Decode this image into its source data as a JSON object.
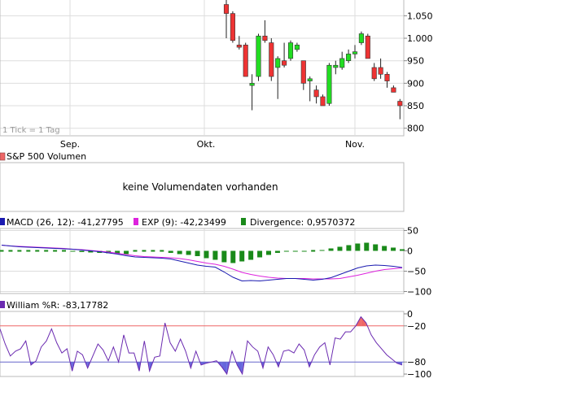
{
  "colors": {
    "up": "#22dd22",
    "down": "#ee3333",
    "grid": "#dddddd",
    "frame": "#bbbbbb",
    "macd": "#1a1ab0",
    "exp": "#dd22dd",
    "divergence": "#1a8a1a",
    "williams": "#6a2ab0",
    "overbought": "#ee6666",
    "oversold": "#6666cc"
  },
  "chart_data": [
    {
      "type": "candlestick",
      "tick_note": "1 Tick = 1 Tag",
      "x_months": [
        "Sep.",
        "Okt.",
        "Nov."
      ],
      "ylim": [
        785,
        1085
      ],
      "yticks": [
        "1.050",
        "1.000",
        "950",
        "900",
        "850",
        "800"
      ],
      "ytick_values": [
        1050,
        1000,
        950,
        900,
        850,
        800
      ],
      "candles": [
        {
          "o": 1075,
          "h": 1085,
          "l": 1000,
          "c": 1055
        },
        {
          "o": 1055,
          "h": 1060,
          "l": 990,
          "c": 995
        },
        {
          "o": 985,
          "h": 1005,
          "l": 975,
          "c": 980
        },
        {
          "o": 985,
          "h": 990,
          "l": 915,
          "c": 915
        },
        {
          "o": 895,
          "h": 920,
          "l": 840,
          "c": 900
        },
        {
          "o": 915,
          "h": 1010,
          "l": 905,
          "c": 1005
        },
        {
          "o": 1005,
          "h": 1040,
          "l": 990,
          "c": 995
        },
        {
          "o": 990,
          "h": 1000,
          "l": 905,
          "c": 915
        },
        {
          "o": 935,
          "h": 960,
          "l": 865,
          "c": 955
        },
        {
          "o": 950,
          "h": 990,
          "l": 935,
          "c": 940
        },
        {
          "o": 955,
          "h": 995,
          "l": 950,
          "c": 990
        },
        {
          "o": 975,
          "h": 990,
          "l": 970,
          "c": 985
        },
        {
          "o": 950,
          "h": 950,
          "l": 885,
          "c": 900
        },
        {
          "o": 905,
          "h": 915,
          "l": 860,
          "c": 910
        },
        {
          "o": 885,
          "h": 895,
          "l": 855,
          "c": 870
        },
        {
          "o": 870,
          "h": 875,
          "l": 850,
          "c": 850
        },
        {
          "o": 855,
          "h": 945,
          "l": 850,
          "c": 940
        },
        {
          "o": 935,
          "h": 950,
          "l": 920,
          "c": 940
        },
        {
          "o": 935,
          "h": 970,
          "l": 930,
          "c": 955
        },
        {
          "o": 950,
          "h": 975,
          "l": 945,
          "c": 965
        },
        {
          "o": 965,
          "h": 985,
          "l": 955,
          "c": 970
        },
        {
          "o": 990,
          "h": 1015,
          "l": 985,
          "c": 1010
        },
        {
          "o": 1005,
          "h": 1010,
          "l": 955,
          "c": 955
        },
        {
          "o": 935,
          "h": 945,
          "l": 905,
          "c": 910
        },
        {
          "o": 935,
          "h": 955,
          "l": 910,
          "c": 920
        },
        {
          "o": 920,
          "h": 925,
          "l": 890,
          "c": 905
        },
        {
          "o": 890,
          "h": 895,
          "l": 880,
          "c": 880
        },
        {
          "o": 860,
          "h": 865,
          "l": 820,
          "c": 850
        }
      ]
    },
    {
      "type": "volume",
      "title": "S&P 500 Volumen",
      "message": "keine Volumendaten vorhanden"
    },
    {
      "type": "line",
      "legend": [
        {
          "name": "MACD (26, 12):",
          "value": "-41,27795"
        },
        {
          "name": "EXP (9):",
          "value": "-42,23499"
        },
        {
          "name": "Divergence:",
          "value": "0,9570372"
        }
      ],
      "ylim": [
        -105,
        55
      ],
      "yticks": [
        50,
        0,
        -50,
        -100
      ],
      "macd": [
        14,
        12,
        10,
        9,
        8,
        7,
        6,
        5,
        4,
        2,
        0,
        -2,
        -5,
        -8,
        -12,
        -15,
        -16,
        -17,
        -18,
        -20,
        -25,
        -30,
        -35,
        -38,
        -40,
        -52,
        -65,
        -74,
        -73,
        -74,
        -72,
        -70,
        -68,
        -68,
        -70,
        -72,
        -70,
        -66,
        -58,
        -50,
        -42,
        -37,
        -35,
        -36,
        -38,
        -41
      ],
      "exp": [
        14,
        12,
        11,
        10,
        9,
        8,
        7,
        6,
        4,
        3,
        1,
        -1,
        -3,
        -6,
        -9,
        -12,
        -14,
        -15,
        -16,
        -17,
        -19,
        -22,
        -26,
        -30,
        -33,
        -38,
        -45,
        -53,
        -58,
        -62,
        -65,
        -67,
        -68,
        -68,
        -68,
        -69,
        -69,
        -69,
        -68,
        -64,
        -60,
        -55,
        -50,
        -46,
        -44,
        -42
      ],
      "divergence_bars": [
        {
          "i": 8,
          "v": -2
        },
        {
          "i": 9,
          "v": -3
        },
        {
          "i": 10,
          "v": -4
        },
        {
          "i": 11,
          "v": -5
        },
        {
          "i": 12,
          "v": -6
        },
        {
          "i": 13,
          "v": -8
        },
        {
          "i": 14,
          "v": -8
        },
        {
          "i": 19,
          "v": -5
        },
        {
          "i": 20,
          "v": -8
        },
        {
          "i": 21,
          "v": -10
        },
        {
          "i": 22,
          "v": -13
        },
        {
          "i": 23,
          "v": -18
        },
        {
          "i": 24,
          "v": -22
        },
        {
          "i": 25,
          "v": -28
        },
        {
          "i": 26,
          "v": -30
        },
        {
          "i": 27,
          "v": -26
        },
        {
          "i": 28,
          "v": -22
        },
        {
          "i": 29,
          "v": -16
        },
        {
          "i": 30,
          "v": -10
        },
        {
          "i": 31,
          "v": -5
        },
        {
          "i": 32,
          "v": -2
        },
        {
          "i": 33,
          "v": -1
        },
        {
          "i": 34,
          "v": -1
        },
        {
          "i": 36,
          "v": 2
        },
        {
          "i": 37,
          "v": 6
        },
        {
          "i": 38,
          "v": 10
        },
        {
          "i": 39,
          "v": 14
        },
        {
          "i": 40,
          "v": 18
        },
        {
          "i": 41,
          "v": 20
        },
        {
          "i": 42,
          "v": 16
        },
        {
          "i": 43,
          "v": 12
        },
        {
          "i": 44,
          "v": 8
        },
        {
          "i": 45,
          "v": 4
        }
      ],
      "divergence_dashes": [
        0,
        1,
        2,
        3,
        4,
        5,
        6,
        7,
        15,
        16,
        17,
        18,
        35
      ]
    },
    {
      "type": "line",
      "legend": [
        {
          "name": "William %R:",
          "value": "-83,17782"
        }
      ],
      "ylim": [
        -104,
        4
      ],
      "yticks": [
        0,
        -20,
        -80,
        -100
      ],
      "levels": [
        -20,
        -80
      ],
      "values": [
        -25,
        -50,
        -70,
        -62,
        -58,
        -45,
        -85,
        -78,
        -55,
        -45,
        -25,
        -48,
        -65,
        -58,
        -95,
        -62,
        -68,
        -90,
        -70,
        -50,
        -60,
        -78,
        -55,
        -80,
        -35,
        -65,
        -65,
        -95,
        -45,
        -95,
        -72,
        -70,
        -15,
        -48,
        -62,
        -42,
        -62,
        -90,
        -62,
        -85,
        -82,
        -80,
        -78,
        -88,
        -100,
        -62,
        -85,
        -100,
        -45,
        -55,
        -62,
        -90,
        -55,
        -68,
        -88,
        -62,
        -60,
        -65,
        -50,
        -60,
        -88,
        -68,
        -55,
        -48,
        -85,
        -40,
        -42,
        -30,
        -30,
        -20,
        -5,
        -15,
        -35,
        -48,
        -58,
        -68,
        -75,
        -82,
        -85
      ],
      "x_range": [
        0,
        78
      ]
    }
  ]
}
